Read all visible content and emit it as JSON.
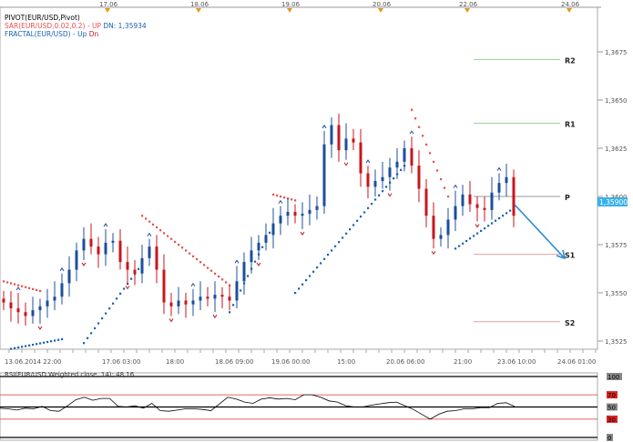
{
  "legend": {
    "pivot": "PIVOT(EUR/USD,Pivot)",
    "sar": "SAR(EUR/USD,0.02,0.2) -",
    "sar_up": "UP",
    "sar_dn": "DN: 1,35934",
    "fractal": "FRACTAL(EUR/USD) -",
    "fractal_up": "Up",
    "fractal_dn": "Dn"
  },
  "colors": {
    "up": "#1c4f9c",
    "down": "#c8161d",
    "sar_up": "#1a62b0",
    "sar_dn": "#e8504a",
    "current": "#3ab0e8",
    "arrow": "#2a8ad6"
  },
  "chart_data": {
    "type": "candlestick",
    "top_dates": [
      "17.06",
      "18.06",
      "19.06",
      "20.06",
      "22.06",
      "24.06"
    ],
    "time_labels": [
      "13.06.2014 22:00",
      "17.06 03:00",
      "18:00",
      "18.06 09:00",
      "19.06 00:00",
      "15:00",
      "20.06 06:00",
      "21:00",
      "23.06 10:00",
      "24.06 01:00"
    ],
    "y_ticks": [
      "1,3675",
      "1,3650",
      "1,3625",
      "1,3600",
      "1,3575",
      "1,3550",
      "1,3525"
    ],
    "ylim": [
      1.3519,
      1.3698
    ],
    "current_price": "1,35900",
    "closes": [
      1.3545,
      1.3542,
      1.354,
      1.3538,
      1.3541,
      1.3543,
      1.3546,
      1.3548,
      1.3555,
      1.3562,
      1.3572,
      1.3578,
      1.3574,
      1.357,
      1.3576,
      1.3577,
      1.3566,
      1.3562,
      1.356,
      1.3568,
      1.3574,
      1.3562,
      1.3545,
      1.3543,
      1.3546,
      1.3544,
      1.3546,
      1.3548,
      1.3547,
      1.3549,
      1.3548,
      1.3546,
      1.3556,
      1.3566,
      1.3572,
      1.3576,
      1.358,
      1.3586,
      1.359,
      1.3592,
      1.359,
      1.3591,
      1.3593,
      1.3595,
      1.3627,
      1.3637,
      1.3624,
      1.363,
      1.3628,
      1.3612,
      1.3605,
      1.3608,
      1.361,
      1.3615,
      1.3618,
      1.3625,
      1.3616,
      1.3604,
      1.359,
      1.3578,
      1.358,
      1.3588,
      1.3595,
      1.3601,
      1.3596,
      1.3594,
      1.3593,
      1.3602,
      1.3607,
      1.361,
      1.359
    ],
    "sar_segments": [
      {
        "dir": "down",
        "from_i": 0,
        "to_i": 5,
        "from": 1.3556,
        "to": 1.3551
      },
      {
        "dir": "up",
        "from_i": 1,
        "to_i": 8,
        "from": 1.3521,
        "to": 1.3526
      },
      {
        "dir": "up",
        "from_i": 11,
        "to_i": 19,
        "from": 1.3524,
        "to": 1.3565
      },
      {
        "dir": "down",
        "from_i": 19,
        "to_i": 31,
        "from": 1.359,
        "to": 1.3554
      },
      {
        "dir": "up",
        "from_i": 31,
        "to_i": 37,
        "from": 1.354,
        "to": 1.3585
      },
      {
        "dir": "down",
        "from_i": 37,
        "to_i": 40,
        "from": 1.3601,
        "to": 1.3598
      },
      {
        "dir": "up",
        "from_i": 40,
        "to_i": 55,
        "from": 1.355,
        "to": 1.3616
      },
      {
        "dir": "down",
        "from_i": 56,
        "to_i": 61,
        "from": 1.3645,
        "to": 1.36
      },
      {
        "dir": "up",
        "from_i": 62,
        "to_i": 70,
        "from": 1.3573,
        "to": 1.3594
      }
    ],
    "pivots": [
      {
        "label": "R2",
        "value": 1.3671
      },
      {
        "label": "R1",
        "value": 1.3638
      },
      {
        "label": "P",
        "value": 1.36
      },
      {
        "label": "S1",
        "value": 1.357
      },
      {
        "label": "S2",
        "value": 1.3535
      }
    ],
    "rsi": {
      "label": "RSI(EUR/USD,Weighted close, 14): 48,16",
      "levels": [
        "100",
        "70",
        "50",
        "30",
        "0"
      ],
      "values": [
        48,
        47,
        45,
        48,
        47,
        51,
        44,
        43,
        52,
        62,
        66,
        61,
        64,
        64,
        51,
        50,
        52,
        48,
        56,
        44,
        43,
        45,
        47,
        47,
        46,
        44,
        55,
        66,
        63,
        58,
        56,
        63,
        65,
        63,
        64,
        62,
        70,
        70,
        66,
        60,
        58,
        52,
        50,
        50,
        53,
        55,
        57,
        58,
        52,
        46,
        38,
        30,
        38,
        43,
        44,
        47,
        47,
        49,
        49,
        56,
        57,
        51
      ]
    }
  }
}
